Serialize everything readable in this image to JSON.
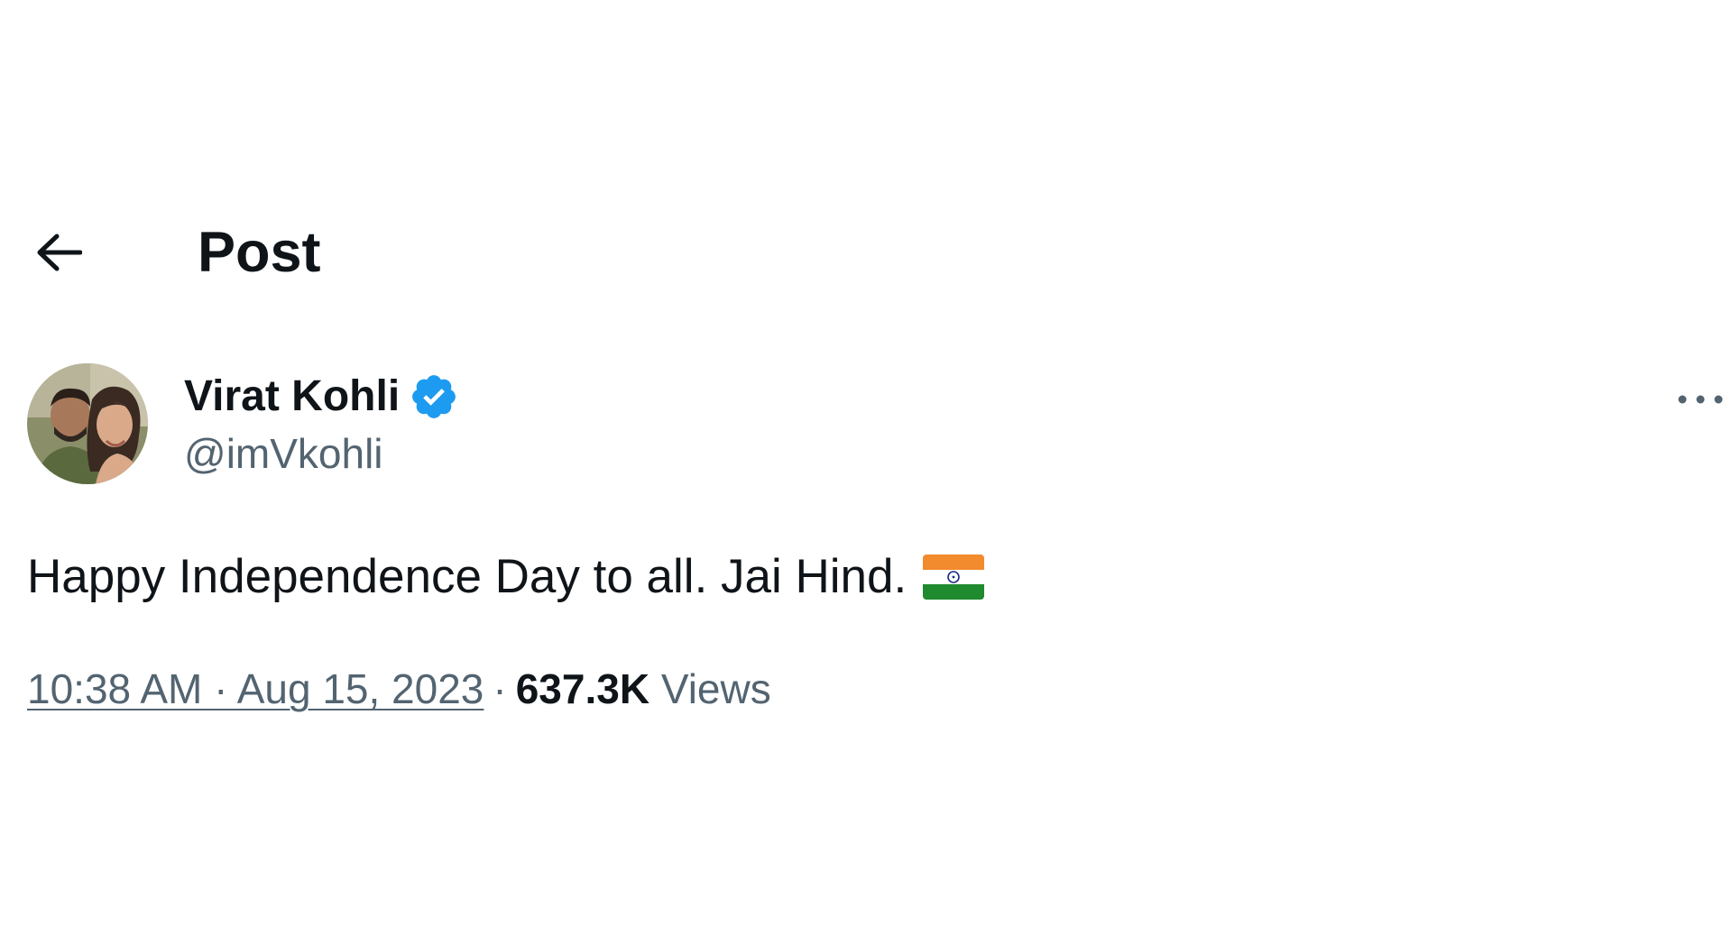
{
  "header": {
    "back_icon": "arrow-left-icon",
    "title": "Post"
  },
  "author": {
    "display_name": "Virat Kohli",
    "handle": "@imVkohli",
    "verified_icon": "verified-badge-icon",
    "verified_color": "#1d9bf0"
  },
  "menu": {
    "more_icon": "more-horizontal-icon"
  },
  "tweet": {
    "text": "Happy Independence Day to all. Jai Hind.",
    "emoji_icon": "india-flag-icon"
  },
  "meta": {
    "timestamp": "10:38 AM · Aug 15, 2023",
    "separator": "·",
    "views_count": "637.3K",
    "views_label": "Views"
  },
  "colors": {
    "text_primary": "#0f1419",
    "text_secondary": "#536471",
    "accent": "#1d9bf0"
  }
}
